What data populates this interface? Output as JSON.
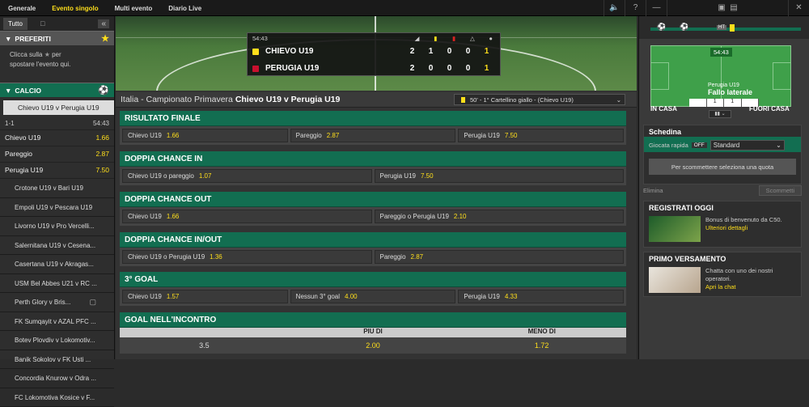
{
  "topnav": {
    "items": [
      "Generale",
      "Evento singolo",
      "Multi evento",
      "Diario Live"
    ],
    "active_index": 1
  },
  "sidebar": {
    "filter_tab": "Tutto",
    "favourites_header": "PREFERITI",
    "favourites_hint_1": "Clicca sulla",
    "favourites_hint_2": "per",
    "favourites_hint_3": "spostare l'evento qui.",
    "calcio_header": "CALCIO",
    "selected_match": "Chievo U19 v Perugia U19",
    "score": "1-1",
    "clock": "54:43",
    "odds": [
      {
        "label": "Chievo U19",
        "value": "1.66"
      },
      {
        "label": "Pareggio",
        "value": "2.87"
      },
      {
        "label": "Perugia U19",
        "value": "7.50"
      }
    ],
    "matches": [
      "Crotone U19 v Bari U19",
      "Empoli U19 v Pescara U19",
      "Livorno U19 v Pro Vercelli...",
      "Salernitana U19 v Cesena...",
      "Casertana U19 v Akragas...",
      "USM Bel Abbes U21 v RC ...",
      "Perth Glory v Bris...",
      "FK Sumqayit v AZAL PFC ...",
      "Botev Plovdiv v Lokomotiv...",
      "Banik Sokolov v FK Usti ...",
      "Concordia Knurow v Odra ...",
      "FC Lokomotiva Kosice v F..."
    ]
  },
  "scoreboard": {
    "clock": "54:43",
    "home": {
      "name": "CHIEVO U19",
      "corners": "2",
      "yellow": "1",
      "red": "0",
      "pen": "0",
      "goals": "1"
    },
    "away": {
      "name": "PERUGIA U19",
      "corners": "2",
      "yellow": "0",
      "red": "0",
      "pen": "0",
      "goals": "1"
    }
  },
  "match_bar": {
    "competition": "Italia - Campionato Primavera",
    "match": "Chievo U19 v Perugia U19",
    "event": "50' - 1° Cartellino giallo - (Chievo U19)"
  },
  "markets": [
    {
      "title": "RISULTATO FINALE",
      "cells": [
        {
          "label": "Chievo U19",
          "price": "1.66"
        },
        {
          "label": "Pareggio",
          "price": "2.87"
        },
        {
          "label": "Perugia U19",
          "price": "7.50"
        }
      ]
    },
    {
      "title": "DOPPIA CHANCE IN",
      "cells": [
        {
          "label": "Chievo U19 o pareggio",
          "price": "1.07"
        },
        {
          "label": "Perugia U19",
          "price": "7.50"
        }
      ]
    },
    {
      "title": "DOPPIA CHANCE OUT",
      "cells": [
        {
          "label": "Chievo U19",
          "price": "1.66"
        },
        {
          "label": "Pareggio o Perugia U19",
          "price": "2.10"
        }
      ]
    },
    {
      "title": "DOPPIA CHANCE IN/OUT",
      "cells": [
        {
          "label": "Chievo U19 o Perugia U19",
          "price": "1.36"
        },
        {
          "label": "Pareggio",
          "price": "2.87"
        }
      ]
    },
    {
      "title": "3° GOAL",
      "cells": [
        {
          "label": "Chievo U19",
          "price": "1.57"
        },
        {
          "label": "Nessun 3° goal",
          "price": "4.00"
        },
        {
          "label": "Perugia U19",
          "price": "4.33"
        }
      ]
    }
  ],
  "goals_market": {
    "title": "GOAL NELL'INCONTRO",
    "col_over": "PIU DI",
    "col_under": "MENO DI",
    "line": "3.5",
    "over": "2.00",
    "under": "1.72"
  },
  "right": {
    "ht": "HT",
    "clock": "54:43",
    "event_team": "Perugia U19",
    "event_name": "Fallo laterale",
    "home_label": "IN CASA",
    "away_label": "FUORI CASA",
    "ctr_vals": [
      "",
      "1",
      "1",
      ""
    ],
    "slip_title": "Schedina",
    "quick_bet": "Giocata rapida",
    "off": "OFF",
    "standard": "Standard",
    "slip_msg": "Per scommettere seleziona una quota",
    "elimina": "Elimina",
    "scommetti": "Scommetti",
    "promo1_title": "REGISTRATI OGGI",
    "promo1_text": "Bonus di benvenuto da C50.",
    "promo1_link": "Ulteriori dettagli",
    "promo2_title": "PRIMO VERSAMENTO",
    "promo2_text": "Chatta con uno dei nostri operatori.",
    "promo2_link": "Apri la chat"
  },
  "colors": {
    "accent": "#126e51",
    "price": "#ffdf1b"
  }
}
